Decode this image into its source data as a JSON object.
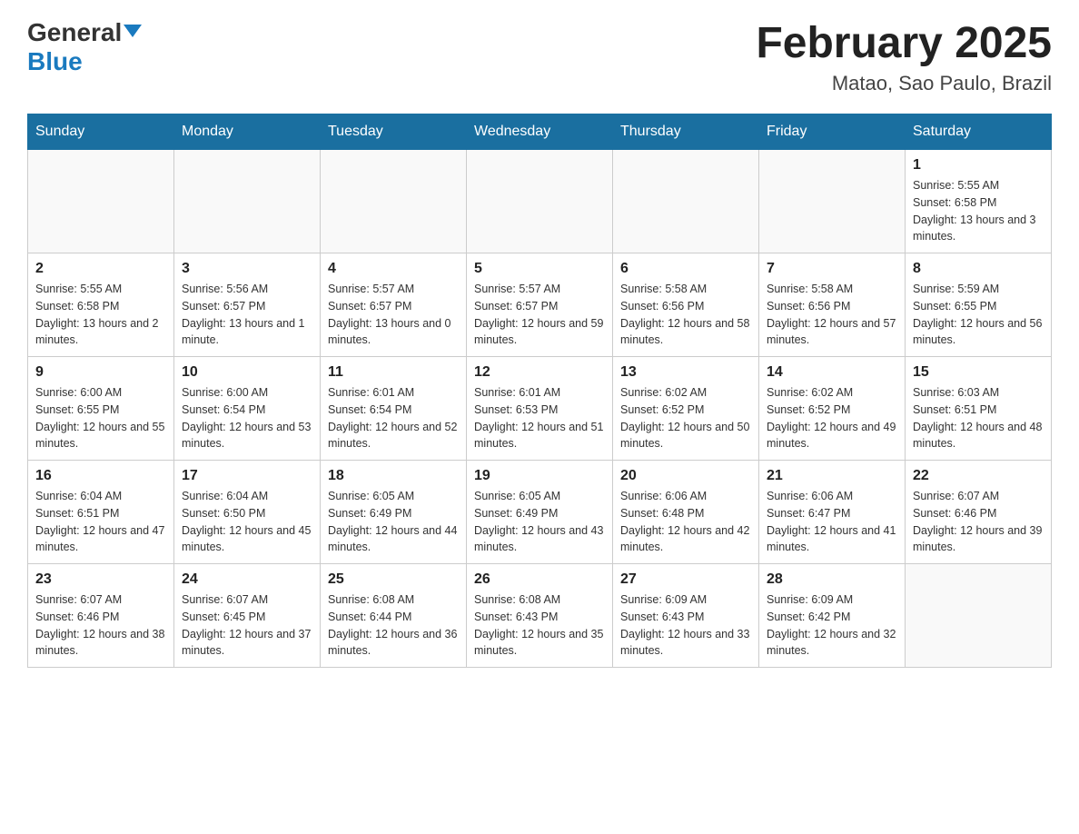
{
  "header": {
    "logo_general": "General",
    "logo_blue": "Blue",
    "title": "February 2025",
    "subtitle": "Matao, Sao Paulo, Brazil"
  },
  "days_of_week": [
    "Sunday",
    "Monday",
    "Tuesday",
    "Wednesday",
    "Thursday",
    "Friday",
    "Saturday"
  ],
  "weeks": [
    [
      {
        "day": "",
        "info": ""
      },
      {
        "day": "",
        "info": ""
      },
      {
        "day": "",
        "info": ""
      },
      {
        "day": "",
        "info": ""
      },
      {
        "day": "",
        "info": ""
      },
      {
        "day": "",
        "info": ""
      },
      {
        "day": "1",
        "info": "Sunrise: 5:55 AM\nSunset: 6:58 PM\nDaylight: 13 hours and 3 minutes."
      }
    ],
    [
      {
        "day": "2",
        "info": "Sunrise: 5:55 AM\nSunset: 6:58 PM\nDaylight: 13 hours and 2 minutes."
      },
      {
        "day": "3",
        "info": "Sunrise: 5:56 AM\nSunset: 6:57 PM\nDaylight: 13 hours and 1 minute."
      },
      {
        "day": "4",
        "info": "Sunrise: 5:57 AM\nSunset: 6:57 PM\nDaylight: 13 hours and 0 minutes."
      },
      {
        "day": "5",
        "info": "Sunrise: 5:57 AM\nSunset: 6:57 PM\nDaylight: 12 hours and 59 minutes."
      },
      {
        "day": "6",
        "info": "Sunrise: 5:58 AM\nSunset: 6:56 PM\nDaylight: 12 hours and 58 minutes."
      },
      {
        "day": "7",
        "info": "Sunrise: 5:58 AM\nSunset: 6:56 PM\nDaylight: 12 hours and 57 minutes."
      },
      {
        "day": "8",
        "info": "Sunrise: 5:59 AM\nSunset: 6:55 PM\nDaylight: 12 hours and 56 minutes."
      }
    ],
    [
      {
        "day": "9",
        "info": "Sunrise: 6:00 AM\nSunset: 6:55 PM\nDaylight: 12 hours and 55 minutes."
      },
      {
        "day": "10",
        "info": "Sunrise: 6:00 AM\nSunset: 6:54 PM\nDaylight: 12 hours and 53 minutes."
      },
      {
        "day": "11",
        "info": "Sunrise: 6:01 AM\nSunset: 6:54 PM\nDaylight: 12 hours and 52 minutes."
      },
      {
        "day": "12",
        "info": "Sunrise: 6:01 AM\nSunset: 6:53 PM\nDaylight: 12 hours and 51 minutes."
      },
      {
        "day": "13",
        "info": "Sunrise: 6:02 AM\nSunset: 6:52 PM\nDaylight: 12 hours and 50 minutes."
      },
      {
        "day": "14",
        "info": "Sunrise: 6:02 AM\nSunset: 6:52 PM\nDaylight: 12 hours and 49 minutes."
      },
      {
        "day": "15",
        "info": "Sunrise: 6:03 AM\nSunset: 6:51 PM\nDaylight: 12 hours and 48 minutes."
      }
    ],
    [
      {
        "day": "16",
        "info": "Sunrise: 6:04 AM\nSunset: 6:51 PM\nDaylight: 12 hours and 47 minutes."
      },
      {
        "day": "17",
        "info": "Sunrise: 6:04 AM\nSunset: 6:50 PM\nDaylight: 12 hours and 45 minutes."
      },
      {
        "day": "18",
        "info": "Sunrise: 6:05 AM\nSunset: 6:49 PM\nDaylight: 12 hours and 44 minutes."
      },
      {
        "day": "19",
        "info": "Sunrise: 6:05 AM\nSunset: 6:49 PM\nDaylight: 12 hours and 43 minutes."
      },
      {
        "day": "20",
        "info": "Sunrise: 6:06 AM\nSunset: 6:48 PM\nDaylight: 12 hours and 42 minutes."
      },
      {
        "day": "21",
        "info": "Sunrise: 6:06 AM\nSunset: 6:47 PM\nDaylight: 12 hours and 41 minutes."
      },
      {
        "day": "22",
        "info": "Sunrise: 6:07 AM\nSunset: 6:46 PM\nDaylight: 12 hours and 39 minutes."
      }
    ],
    [
      {
        "day": "23",
        "info": "Sunrise: 6:07 AM\nSunset: 6:46 PM\nDaylight: 12 hours and 38 minutes."
      },
      {
        "day": "24",
        "info": "Sunrise: 6:07 AM\nSunset: 6:45 PM\nDaylight: 12 hours and 37 minutes."
      },
      {
        "day": "25",
        "info": "Sunrise: 6:08 AM\nSunset: 6:44 PM\nDaylight: 12 hours and 36 minutes."
      },
      {
        "day": "26",
        "info": "Sunrise: 6:08 AM\nSunset: 6:43 PM\nDaylight: 12 hours and 35 minutes."
      },
      {
        "day": "27",
        "info": "Sunrise: 6:09 AM\nSunset: 6:43 PM\nDaylight: 12 hours and 33 minutes."
      },
      {
        "day": "28",
        "info": "Sunrise: 6:09 AM\nSunset: 6:42 PM\nDaylight: 12 hours and 32 minutes."
      },
      {
        "day": "",
        "info": ""
      }
    ]
  ]
}
